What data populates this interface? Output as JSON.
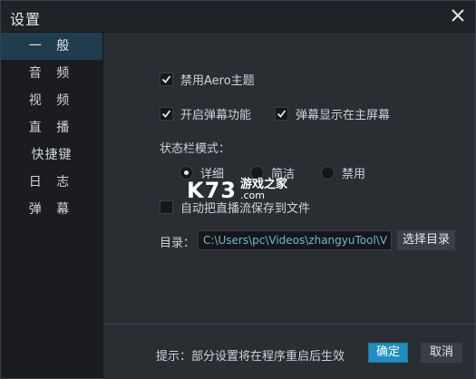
{
  "window": {
    "title": "设置"
  },
  "sidebar": {
    "items": [
      {
        "label": "一 般",
        "active": true
      },
      {
        "label": "音 频",
        "active": false
      },
      {
        "label": "视 频",
        "active": false
      },
      {
        "label": "直 播",
        "active": false
      },
      {
        "label": "快捷键",
        "active": false
      },
      {
        "label": "日 志",
        "active": false
      },
      {
        "label": "弹 幕",
        "active": false
      }
    ]
  },
  "general": {
    "disable_aero": {
      "label": "禁用Aero主题",
      "checked": true
    },
    "enable_danmaku": {
      "label": "开启弹幕功能",
      "checked": true
    },
    "danmaku_main_screen": {
      "label": "弹幕显示在主屏幕",
      "checked": true
    },
    "statusbar_mode": {
      "label": "状态栏模式：",
      "options": [
        "详细",
        "简洁",
        "禁用"
      ],
      "selected": "详细"
    },
    "auto_save_stream": {
      "label": "自动把直播流保存到文件",
      "checked": false
    },
    "directory": {
      "label": "目录：",
      "value": "C:\\Users\\pc\\Videos\\zhangyuTool\\V",
      "browse_label": "选择目录"
    }
  },
  "footer": {
    "hint": "提示：部分设置将在程序重启后生效",
    "ok_label": "确定",
    "cancel_label": "取消"
  },
  "watermark": {
    "logo": "K73",
    "text": "游戏之家",
    "url": ".com"
  },
  "colors": {
    "accent": "#1f8fc0",
    "sidebar_active": "#1f3d4f",
    "path_text": "#6fb8d4"
  }
}
